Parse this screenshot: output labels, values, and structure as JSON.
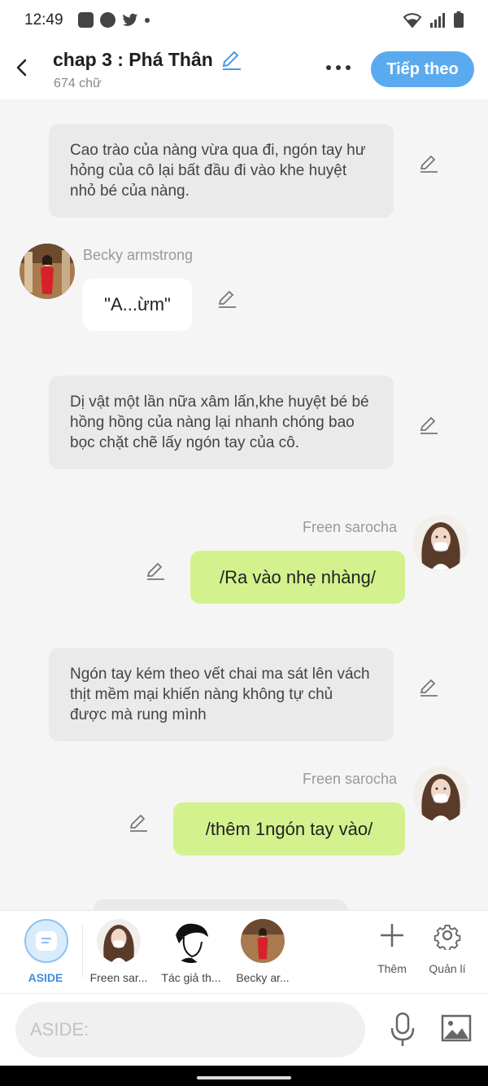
{
  "status_bar": {
    "time": "12:49",
    "left_icons": [
      "baomoi-icon",
      "compass-icon",
      "twitter-icon",
      "dot-icon"
    ],
    "right_icons": [
      "wifi-icon",
      "signal-icon",
      "battery-icon"
    ]
  },
  "header": {
    "title": "chap 3 : Phá Thân",
    "word_count": "674 chữ",
    "next_label": "Tiếp theo"
  },
  "messages": [
    {
      "type": "narration",
      "text": "Cao trào của nàng vừa qua đi, ngón tay hư hỏng  của cô lại bất đầu đi vào khe huyệt nhỏ bé của nàng."
    },
    {
      "type": "left",
      "name": "Becky armstrong",
      "text": "\"A...ừm\""
    },
    {
      "type": "narration",
      "text": "Dị vật một lần nữa xâm lấn,khe huyệt bé bé hồng hồng của nàng lại nhanh chóng bao bọc chặt chẽ lấy ngón tay của cô."
    },
    {
      "type": "right",
      "name": "Freen sarocha",
      "text": "/Ra vào nhẹ nhàng/"
    },
    {
      "type": "narration",
      "text": "Ngón tay kém theo vết chai ma sát lên vách thịt mềm mại khiến nàng không tự chủ được mà rung mình"
    },
    {
      "type": "right",
      "name": "Freen sarocha",
      "text": "/thêm 1ngón tay vào/"
    }
  ],
  "character_bar": {
    "aside_label": "ASIDE",
    "characters": [
      {
        "label": "Freen sar..."
      },
      {
        "label": "Tác giả th..."
      },
      {
        "label": "Becky ar..."
      }
    ],
    "add_label": "Thêm",
    "manage_label": "Quản lí"
  },
  "input": {
    "placeholder": "ASIDE:",
    "value": ""
  },
  "colors": {
    "accent": "#5aaaf0",
    "right_bubble": "#d3f28e",
    "narration_bg": "#eaeaea",
    "background": "#f5f5f5"
  }
}
